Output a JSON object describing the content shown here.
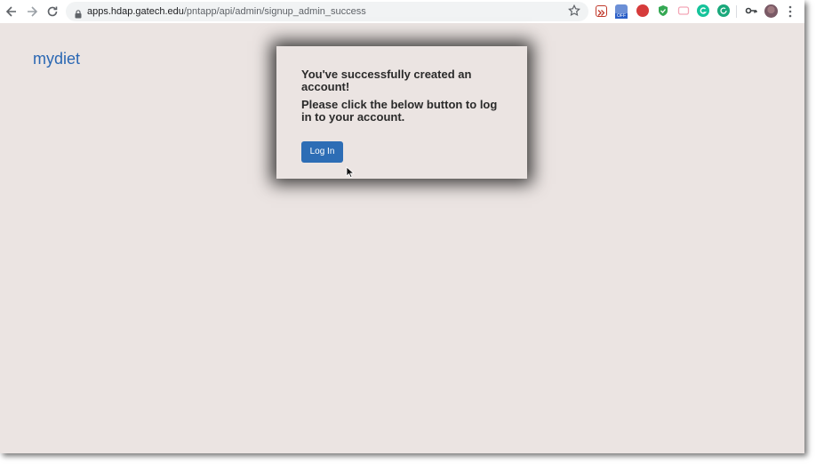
{
  "browser": {
    "url_domain": "apps.hdap.gatech.edu",
    "url_path": "/pntapp/api/admin/signup_admin_success",
    "extensions": [
      {
        "name": "forward-ext-icon",
        "color": "#c0392b"
      },
      {
        "name": "off-ext-icon",
        "color": "#4a7bd0",
        "badge": "OFF"
      },
      {
        "name": "red-ext-icon",
        "color": "#d63b3b"
      },
      {
        "name": "shield-ext-icon",
        "color": "#34a853"
      },
      {
        "name": "pink-ext-icon",
        "color": "#f3a6b6"
      },
      {
        "name": "grammarly-ext-icon",
        "color": "#15c39a"
      },
      {
        "name": "refresh-ext-icon",
        "color": "#1aa87b"
      },
      {
        "name": "key-icon",
        "color": "#5f6368"
      }
    ]
  },
  "page": {
    "brand": "mydiet",
    "modal": {
      "line1": "You've successfully created an account!",
      "line2": "Please click the below button to log in to your account.",
      "button": "Log In"
    }
  },
  "colors": {
    "accent": "#2d6db5",
    "brand_text": "#2a67b3",
    "background": "#ebe4e2"
  }
}
